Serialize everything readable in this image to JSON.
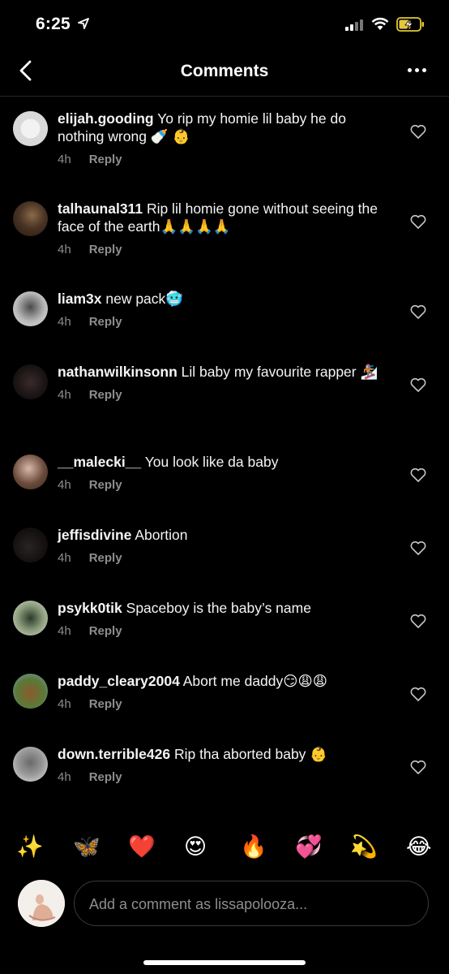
{
  "status_bar": {
    "time": "6:25"
  },
  "header": {
    "title": "Comments"
  },
  "comments": [
    {
      "username": "elijah.gooding",
      "text": "Yo rip my homie lil baby he do nothing wrong 🍼 👶",
      "age": "4h",
      "reply_label": "Reply"
    },
    {
      "username": "talhaunal311",
      "text": "Rip lil homie gone without seeing the face of the earth🙏🙏🙏🙏",
      "age": "4h",
      "reply_label": "Reply"
    },
    {
      "username": "liam3x",
      "text": "new pack🥶",
      "age": "4h",
      "reply_label": "Reply"
    },
    {
      "username": "nathanwilkinsonn",
      "text": "Lil baby my favourite rapper 🏂",
      "age": "4h",
      "reply_label": "Reply"
    },
    {
      "username": "__malecki__",
      "text": "You look like da baby",
      "age": "4h",
      "reply_label": "Reply"
    },
    {
      "username": "jeffisdivine",
      "text": "Abortion",
      "age": "4h",
      "reply_label": "Reply"
    },
    {
      "username": "psykk0tik",
      "text": "Spaceboy is the baby’s name",
      "age": "4h",
      "reply_label": "Reply"
    },
    {
      "username": "paddy_cleary2004",
      "text": "Abort me daddy😏😩😩",
      "age": "4h",
      "reply_label": "Reply"
    },
    {
      "username": "down.terrible426",
      "text": "Rip tha aborted baby 👶",
      "age": "4h",
      "reply_label": "Reply"
    }
  ],
  "emoji_bar": [
    "✨",
    "🦋",
    "❤️",
    "😍",
    "🔥",
    "💞",
    "💫",
    "😂"
  ],
  "composer": {
    "placeholder": "Add a comment as lissapolooza..."
  },
  "colors": {
    "background": "#000000",
    "secondary_text": "#8e8e8e",
    "divider": "#262626"
  }
}
